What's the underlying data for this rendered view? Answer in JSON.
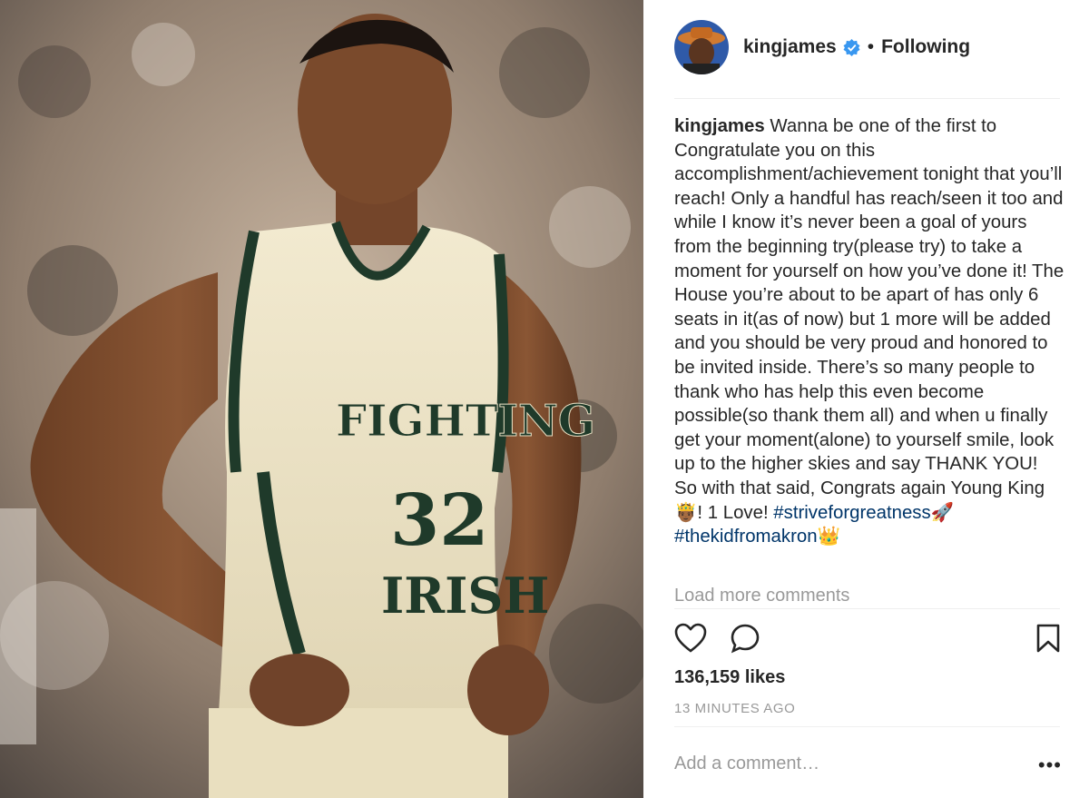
{
  "post": {
    "username": "kingjames",
    "separator": "•",
    "follow_status": "Following",
    "caption_user": "kingjames",
    "caption_text": "Wanna be one of the first to Congratulate you on this accomplishment/achievement tonight that you’ll reach! Only a handful has reach/seen it too and while I know it’s never been a goal of yours from the beginning try(please try) to take a moment for yourself on how you’ve done it! The House you’re about to be apart of has only 6 seats in it(as of now) but 1 more will be added and you should be very proud and honored to be invited inside. There’s so many people to thank who has help this even become possible(so thank them all) and when u finally get your moment(alone) to yourself smile, look up to the higher skies and say THANK YOU! So with that said, Congrats again Young King 🤴🏾! 1 Love!",
    "hashtag_1": "#striveforgreatness🚀",
    "hashtag_2": "#thekidfromakron👑",
    "load_more": "Load more comments",
    "likes": "136,159 likes",
    "timestamp": "13 MINUTES AGO",
    "comment_placeholder": "Add a comment…",
    "more_options": "•••",
    "jersey_text_top": "FIGHTING",
    "jersey_text_bottom": "IRISH",
    "jersey_number": "32"
  },
  "colors": {
    "text": "#262626",
    "muted": "#999999",
    "hashtag": "#003569",
    "verified": "#3897f0"
  },
  "icons": [
    "verified-badge-icon",
    "heart-icon",
    "comment-icon",
    "bookmark-icon",
    "more-options-icon"
  ]
}
